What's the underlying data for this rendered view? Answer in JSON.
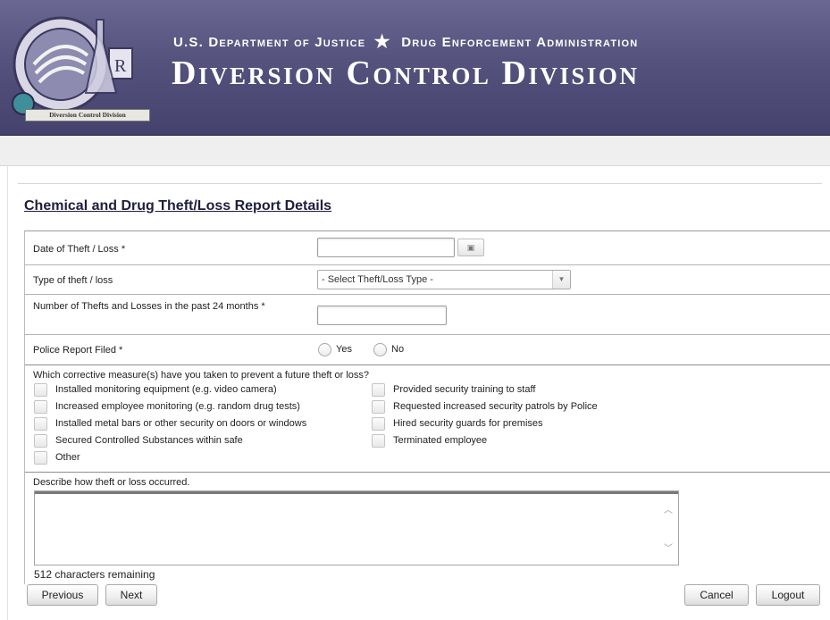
{
  "header": {
    "department_line_1": "U.S. Department of Justice",
    "department_line_2": "Drug Enforcement Administration",
    "division_title": "Diversion Control Division",
    "seal_label": "Diversion Control Division"
  },
  "page": {
    "title": "Chemical and Drug Theft/Loss Report Details"
  },
  "form": {
    "date_label": "Date of Theft / Loss *",
    "date_value": "",
    "type_label": "Type of theft / loss",
    "type_selected": "- Select Theft/Loss Type -",
    "count_label": "Number of Thefts and Losses in the past 24 months *",
    "count_value": "",
    "police_label": "Police Report Filed *",
    "police_yes": "Yes",
    "police_no": "No",
    "measures_question": "Which corrective measure(s) have you taken to prevent a future theft or loss?",
    "measures_left": [
      "Installed monitoring equipment (e.g. video camera)",
      "Increased employee monitoring (e.g. random drug tests)",
      "Installed metal bars or other security on doors or windows",
      "Secured Controlled Substances within safe",
      "Other"
    ],
    "measures_right": [
      "Provided security training to staff",
      "Requested increased security patrols by Police",
      "Hired security guards for premises",
      "Terminated employee"
    ],
    "describe_label": "Describe how theft or loss occurred.",
    "describe_value": "",
    "chars_remaining": "512 characters remaining"
  },
  "buttons": {
    "previous": "Previous",
    "next": "Next",
    "cancel": "Cancel",
    "logout": "Logout"
  },
  "icons": {
    "calendar": "calendar-icon",
    "select_arrow": "chevron-down-icon"
  },
  "colors": {
    "banner": "#55527d",
    "title": "#1e1e3c"
  }
}
